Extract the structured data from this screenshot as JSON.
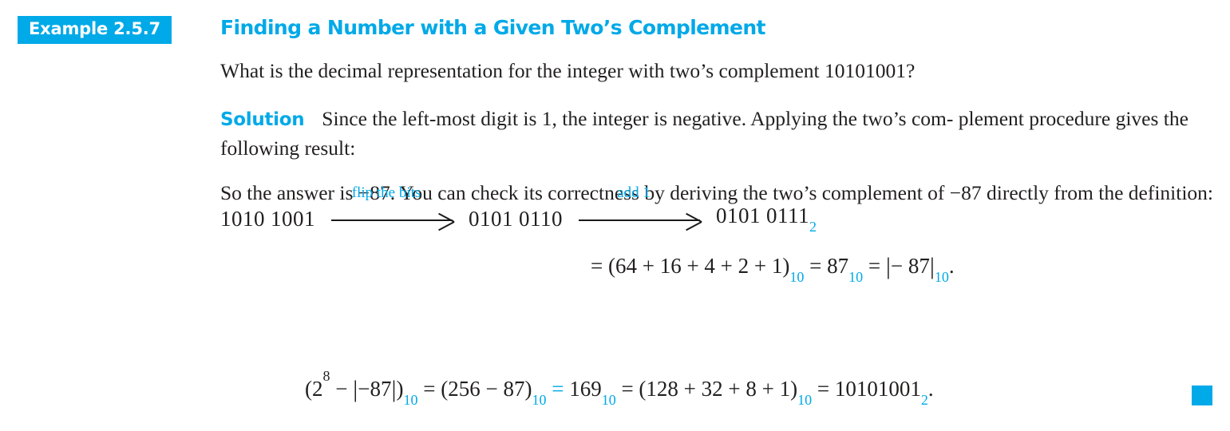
{
  "colors": {
    "accent": "#00a9e8",
    "text": "#221f1f",
    "background": "#ffffff"
  },
  "example": {
    "badge_label": "Example 2.5.7",
    "title": "Finding a Number with a Given Two’s Complement"
  },
  "question": {
    "text": "What is the decimal representation for the integer with two’s complement 10101001?"
  },
  "solution": {
    "label": "Solution",
    "paragraph_line1": "Since the left-most digit is 1, the integer is negative. Applying the two’s com-",
    "paragraph_line2": "plement procedure gives the following result:"
  },
  "derivation": {
    "start_bits_left": "1010",
    "start_bits_right": "1001",
    "arrow1_label": "flip the bits",
    "middle_bits_left": "0101",
    "middle_bits_right": "0110",
    "arrow2_label": "add 1",
    "result_bits_left": "0101",
    "result_bits_right": "0111",
    "result_subscript": "2",
    "expansion": {
      "equals": "=",
      "sum_expr": "(64 + 16 + 4 + 2 + 1)",
      "sub_10_a": "10",
      "equals2": "=",
      "value_87": "87",
      "sub_10_b": "10",
      "equals3": "=",
      "abs_open": "|",
      "abs_value": "− 87",
      "abs_close": "|",
      "sub_10_c": "10",
      "period": "."
    }
  },
  "conclusion": {
    "line1": "So the answer is −87. You can check its correctness by deriving the two’s complement of",
    "line2": "−87 directly from the definition:"
  },
  "check_equation": {
    "open_paren": "(",
    "base_2": "2",
    "exponent_8": "8",
    "minus": "−",
    "abs_open": "|",
    "abs_value": "−87",
    "abs_close": "|",
    "close_paren": ")",
    "sub_10_a": "10",
    "equals1": "=",
    "paren_expr": "(256 − 87)",
    "sub_10_b": "10",
    "equals2": "=",
    "value_169": "169",
    "sub_10_c": "10",
    "equals3": "=",
    "sum_expr": "(128 + 32 + 8 + 1)",
    "sub_10_d": "10",
    "equals4": "=",
    "binary_result": "10101001",
    "sub_2": "2",
    "period": "."
  },
  "end_of_proof_marker": "■"
}
